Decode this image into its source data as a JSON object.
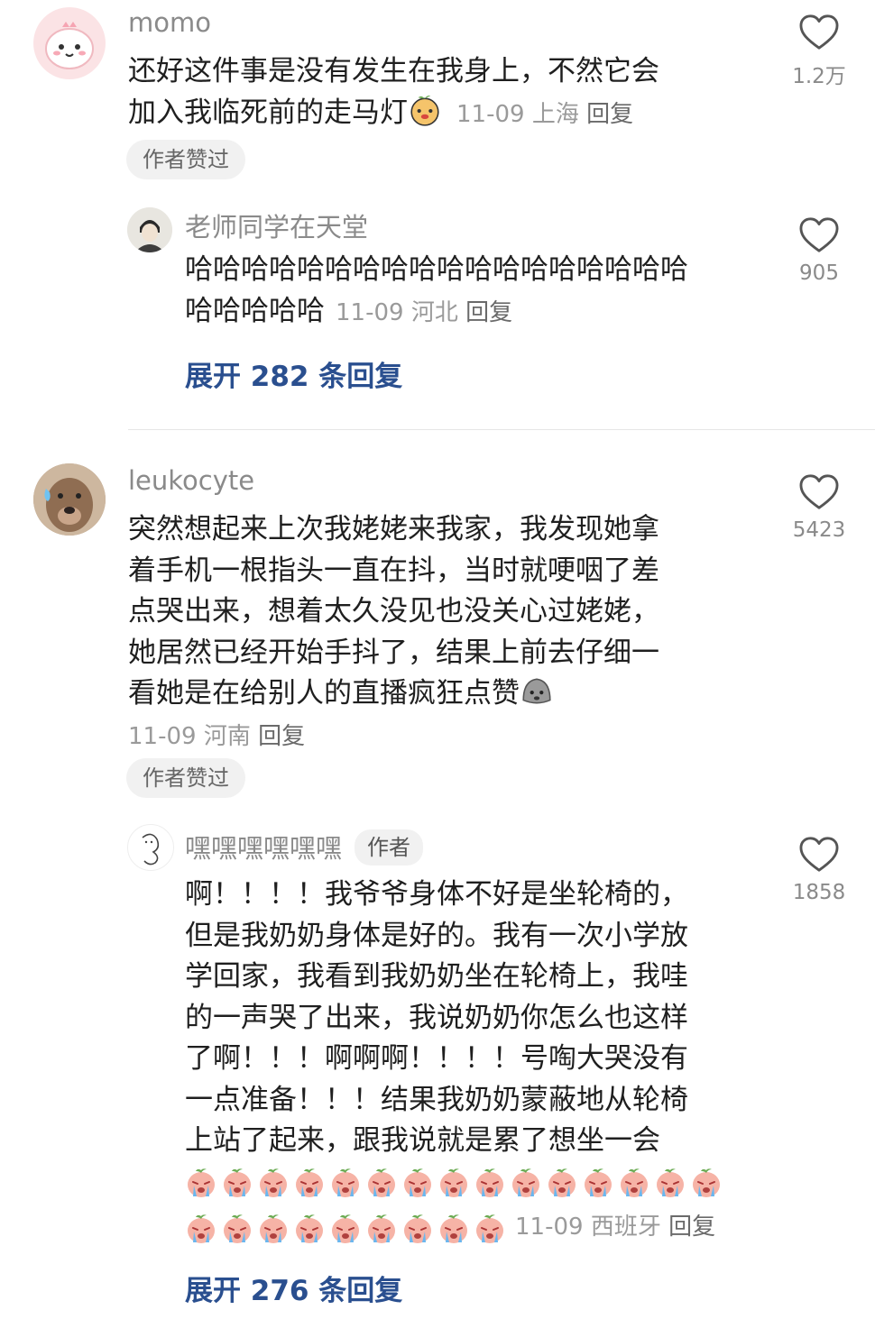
{
  "comments": [
    {
      "username": "momo",
      "lines": [
        "还好这件事是没有发生在我身上，不然它会",
        "加入我临死前的走马灯"
      ],
      "date": "11-09",
      "location": "上海",
      "reply_label": "回复",
      "badge": "作者赞过",
      "likes": "1.2万"
    },
    {
      "username": "老师同学在天堂",
      "lines": [
        "哈哈哈哈哈哈哈哈哈哈哈哈哈哈哈哈哈哈",
        "哈哈哈哈哈"
      ],
      "date": "11-09",
      "location": "河北",
      "reply_label": "回复",
      "likes": "905",
      "expand": "展开 282 条回复"
    },
    {
      "username": "leukocyte",
      "lines": [
        "突然想起来上次我姥姥来我家，我发现她拿",
        "着手机一根指头一直在抖，当时就哽咽了差",
        "点哭出来，想着太久没见也没关心过姥姥，",
        "她居然已经开始手抖了，结果上前去仔细一",
        "看她是在给别人的直播疯狂点赞"
      ],
      "date": "11-09",
      "location": "河南",
      "reply_label": "回复",
      "badge": "作者赞过",
      "likes": "5423"
    },
    {
      "username": "嘿嘿嘿嘿嘿嘿",
      "author_tag": "作者",
      "lines": [
        "啊！！！！我爷爷身体不好是坐轮椅的，",
        "但是我奶奶身体是好的。我有一次小学放",
        "学回家，我看到我奶奶坐在轮椅上，我哇",
        "的一声哭了出来，我说奶奶你怎么也这样",
        "了啊！！！啊啊啊！！！！号啕大哭没有",
        "一点准备！！！结果我奶奶蒙蔽地从轮椅",
        "上站了起来，跟我说就是累了想坐一会"
      ],
      "date": "11-09",
      "location": "西班牙",
      "reply_label": "回复",
      "likes": "1858",
      "expand": "展开 276 条回复"
    }
  ],
  "icons": {
    "like": "heart-outline-icon",
    "emoji_1": "sly-face-emoji",
    "emoji_2": "rock-face-emoji",
    "emoji_3": "crying-peach-emoji"
  },
  "colors": {
    "expand_link": "#2a4f8f",
    "meta_text": "#9a9a9a",
    "username": "#8a8a8a"
  },
  "cry_emoji_count_row1": 15,
  "cry_emoji_count_row2": 9
}
